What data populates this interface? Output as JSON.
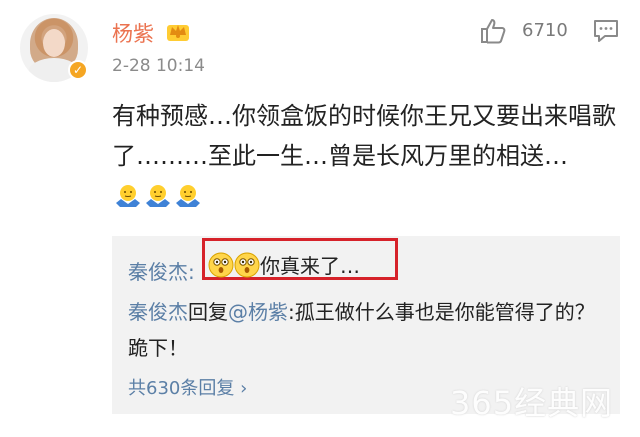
{
  "post": {
    "username": "杨紫",
    "timestamp": "2-28 10:14",
    "like_count": "6710",
    "text": "有种预感…你领盒饭的时候你王兄又要出来唱歌了………至此一生…曾是长风万里的相送…",
    "emoji_icons": [
      "shrug-emoji",
      "shrug-emoji",
      "shrug-emoji"
    ]
  },
  "replies": {
    "first": {
      "author": "秦俊杰",
      "separator": ":",
      "content": "你真来了…"
    },
    "second": {
      "author": "秦俊杰",
      "action": "回复",
      "mention": "@杨紫",
      "content": ":孤王做什么事也是你能管得了的？跪下！"
    },
    "more": "共630条回复",
    "more_arrow": "›"
  },
  "watermark": "365经典网",
  "colors": {
    "username": "#eb7350",
    "link": "#5b7fa6",
    "highlight": "#d6222a",
    "reply_bg": "#f2f2f2"
  }
}
